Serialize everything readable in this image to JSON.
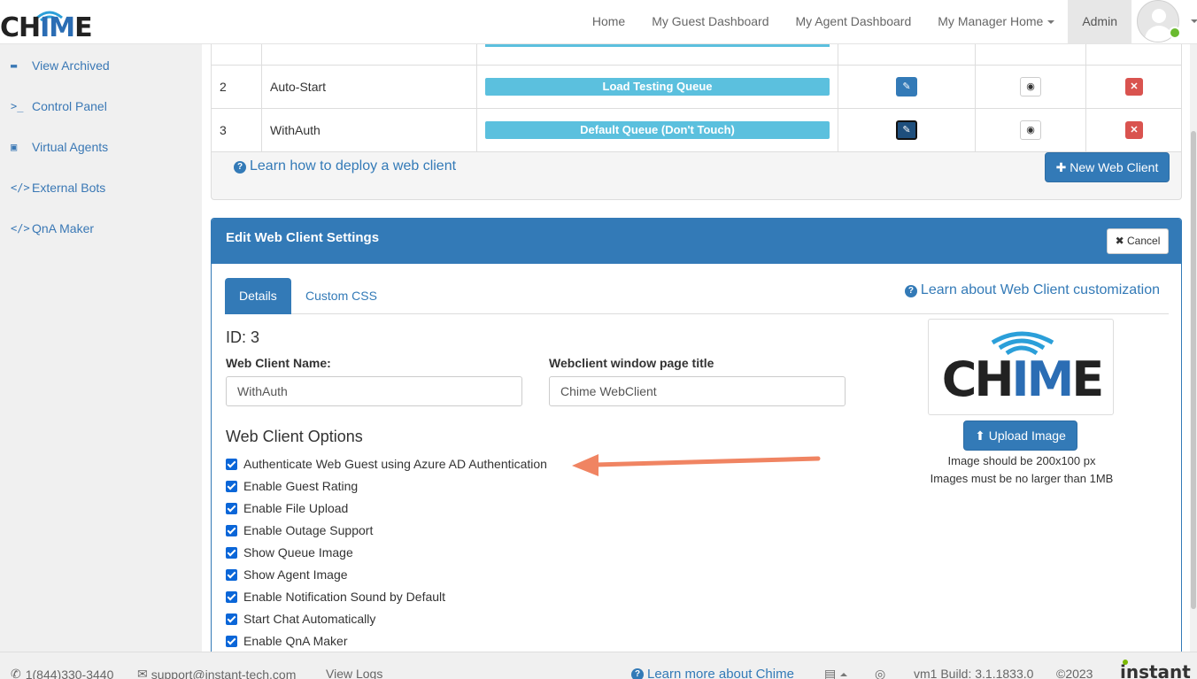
{
  "brand": {
    "logo_prefix": "CH",
    "logo_mid": "IM",
    "logo_suffix": "E"
  },
  "nav": {
    "home": "Home",
    "guest_dashboard": "My Guest Dashboard",
    "agent_dashboard": "My Agent Dashboard",
    "manager_home": "My Manager Home",
    "admin": "Admin"
  },
  "sidebar": {
    "items": [
      {
        "label": "View Archived",
        "icon": "archive-icon"
      },
      {
        "label": "Control Panel",
        "icon": "terminal-icon"
      },
      {
        "label": "Virtual Agents",
        "icon": "android-icon"
      },
      {
        "label": "External Bots",
        "icon": "code-icon"
      },
      {
        "label": "QnA Maker",
        "icon": "code-icon"
      }
    ]
  },
  "table": {
    "rows": [
      {
        "id": "2",
        "name": "Auto-Start",
        "queue": "Load Testing Queue"
      },
      {
        "id": "3",
        "name": "WithAuth",
        "queue": "Default Queue (Don't Touch)"
      }
    ],
    "learn_deploy": "Learn how to deploy a web client",
    "new_button": "New Web Client"
  },
  "edit": {
    "title": "Edit Web Client Settings",
    "cancel": "Cancel",
    "tabs": [
      "Details",
      "Custom CSS"
    ],
    "learn_custom": "Learn about Web Client customization",
    "id_text": "ID: 3",
    "name_label": "Web Client Name:",
    "name_value": "WithAuth",
    "page_title_label": "Webclient window page title",
    "page_title_value": "Chime WebClient",
    "options_title": "Web Client Options",
    "options": [
      {
        "label": "Authenticate Web Guest using Azure AD Authentication",
        "checked": true
      },
      {
        "label": "Enable Guest Rating",
        "checked": true
      },
      {
        "label": "Enable File Upload",
        "checked": true
      },
      {
        "label": "Enable Outage Support",
        "checked": true
      },
      {
        "label": "Show Queue Image",
        "checked": true
      },
      {
        "label": "Show Agent Image",
        "checked": true
      },
      {
        "label": "Enable Notification Sound by Default",
        "checked": true
      },
      {
        "label": "Start Chat Automatically",
        "checked": true
      },
      {
        "label": "Enable QnA Maker",
        "checked": true
      }
    ],
    "upload_button": "Upload Image",
    "upload_note_1": "Image should be 200x100 px",
    "upload_note_2": "Images must be no larger than 1MB"
  },
  "footer": {
    "phone": "1(844)330-3440",
    "email": "support@instant-tech.com",
    "view_logs": "View Logs",
    "learn_more": "Learn more about Chime",
    "build": "vm1 Build: 3.1.1833.0",
    "copyright": "©2023",
    "brand": "instant"
  },
  "colors": {
    "primary": "#337ab7",
    "queue": "#5bc0de",
    "danger": "#d9534f",
    "arrow": "#f08462",
    "status": "#6aba2f"
  }
}
